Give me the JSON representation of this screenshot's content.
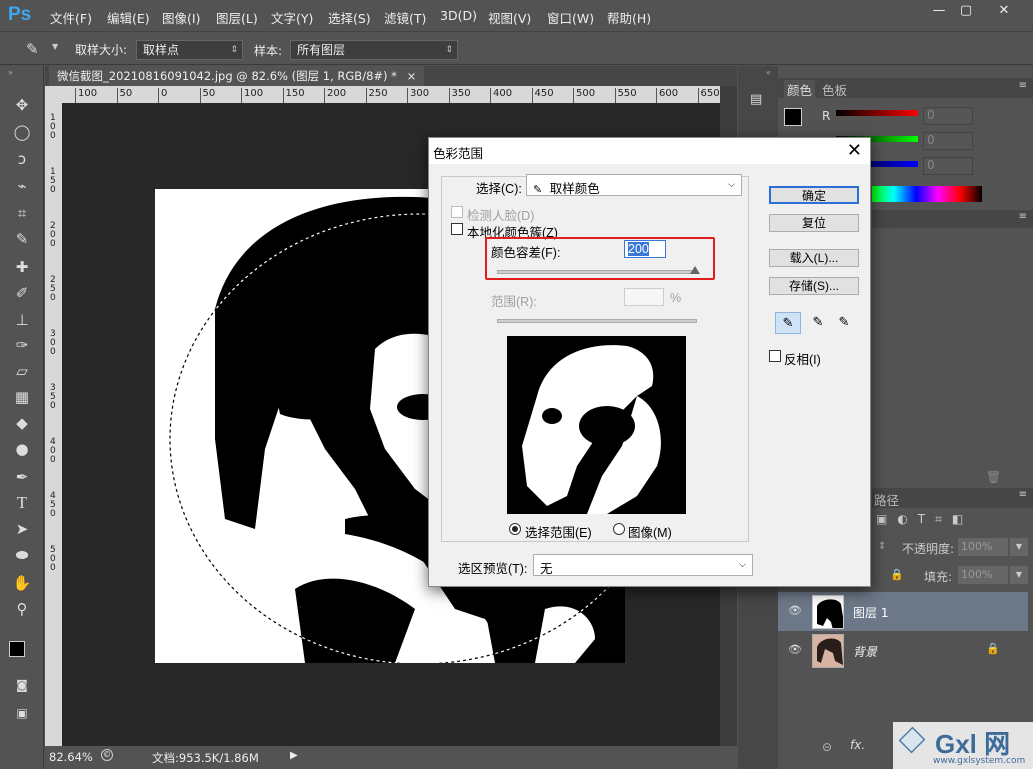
{
  "app": {
    "logo": "Ps"
  },
  "menu": [
    "文件(F)",
    "编辑(E)",
    "图像(I)",
    "图层(L)",
    "文字(Y)",
    "选择(S)",
    "滤镜(T)",
    "3D(D)",
    "视图(V)",
    "窗口(W)",
    "帮助(H)"
  ],
  "window_controls": {
    "minimize": "—",
    "maximize": "▢",
    "close": "✕"
  },
  "options": {
    "sample_size_label": "取样大小:",
    "sample_size_value": "取样点",
    "sample_label": "样本:",
    "sample_value": "所有图层"
  },
  "document": {
    "tab_title": "微信截图_20210816091042.jpg @ 82.6% (图层 1, RGB/8#) *",
    "tab_close": "×",
    "ruler_ticks": [
      "100",
      "50",
      "0",
      "50",
      "100",
      "150",
      "200",
      "250",
      "300",
      "350",
      "400",
      "450",
      "500",
      "550",
      "600",
      "650"
    ],
    "ruler_left": [
      "1",
      "0",
      "0",
      "1",
      "5",
      "0",
      "2",
      "0",
      "0",
      "2",
      "5",
      "0",
      "3",
      "0",
      "0",
      "3",
      "5",
      "0",
      "4",
      "0",
      "0",
      "4",
      "5",
      "0",
      "5",
      "0",
      "0"
    ],
    "zoom": "82.64%",
    "doc_size": "文档:953.5K/1.86M",
    "play": "▶"
  },
  "right_panel": {
    "tabs": [
      "颜色",
      "色板"
    ],
    "channels": [
      {
        "label": "R",
        "value": "0",
        "color": "#ff0000"
      },
      {
        "label": "G",
        "value": "0",
        "color": "#00ff00"
      },
      {
        "label": "B",
        "value": "0",
        "color": "#0000ff"
      }
    ],
    "layers_tab": "路径",
    "opacity_label": "不透明度:",
    "opacity_value": "100%",
    "fill_label": "填充:",
    "fill_value": "100%",
    "layers": [
      {
        "name": "图层 1"
      },
      {
        "name": "背景"
      }
    ],
    "bottom_icons": [
      "link-icon",
      "fx-icon"
    ],
    "fx_label": "fx."
  },
  "dialog": {
    "title": "色彩范围",
    "close": "✕",
    "select_label": "选择(C):",
    "select_value": "取样颜色",
    "detect_faces": "检测人脸(D)",
    "localized": "本地化颜色簇(Z)",
    "fuzziness_label": "颜色容差(F):",
    "fuzziness_value": "200",
    "range_label": "范围(R):",
    "range_unit": "%",
    "radio_selection": "选择范围(E)",
    "radio_image": "图像(M)",
    "preview_label": "选区预览(T):",
    "preview_value": "无",
    "ok": "确定",
    "reset": "复位",
    "load": "载入(L)...",
    "save": "存储(S)...",
    "invert": "反相(I)",
    "accent_color": "#e31d1d"
  },
  "watermark": {
    "text": "Gxl 网",
    "url_text": "www.gxlsystem.com"
  }
}
